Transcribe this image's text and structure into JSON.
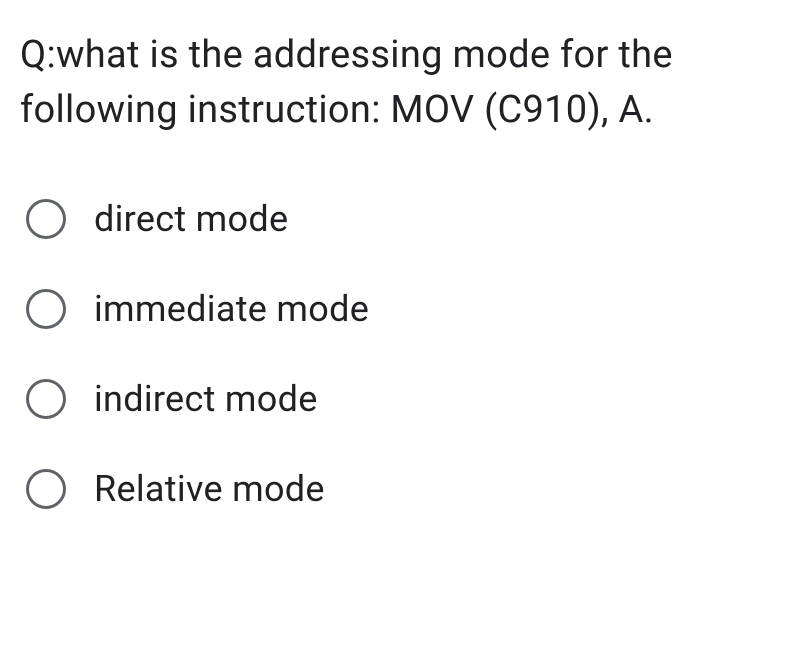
{
  "question": {
    "text": "Q:what is the addressing mode for the following instruction:   MOV (C910), A."
  },
  "options": [
    {
      "label": "direct mode"
    },
    {
      "label": "immediate mode"
    },
    {
      "label": "indirect mode"
    },
    {
      "label": "Relative mode"
    }
  ]
}
